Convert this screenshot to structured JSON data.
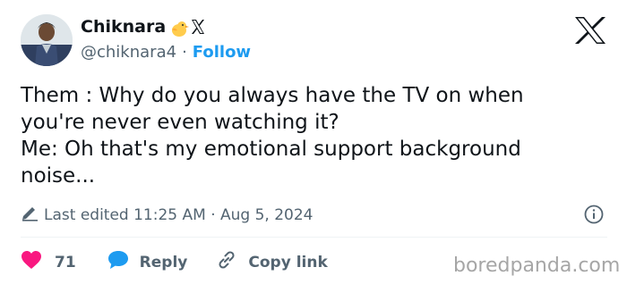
{
  "author": {
    "name": "Chiknara",
    "badge_emoji": "🐤",
    "handle": "@chiknara4",
    "separator": "·",
    "follow_label": "Follow"
  },
  "tweet": {
    "text": "Them : Why do you always have the TV on when\nyou're never even watching it?\nMe: Oh that's my emotional support background\nnoise..."
  },
  "meta": {
    "edited_label": "Last edited 11:25 AM · Aug 5, 2024"
  },
  "actions": {
    "like_count": "71",
    "reply_label": "Reply",
    "copy_link_label": "Copy link"
  },
  "watermark": "boredpanda.com",
  "colors": {
    "like": "#f91880",
    "reply": "#1d9bf0",
    "follow": "#1d9bf0",
    "secondary_text": "#536471"
  },
  "icons": [
    "avatar",
    "chick-emoji-icon",
    "x-badge-icon",
    "x-logo-icon",
    "pencil-icon",
    "info-icon",
    "heart-icon",
    "reply-bubble-icon",
    "link-icon"
  ]
}
